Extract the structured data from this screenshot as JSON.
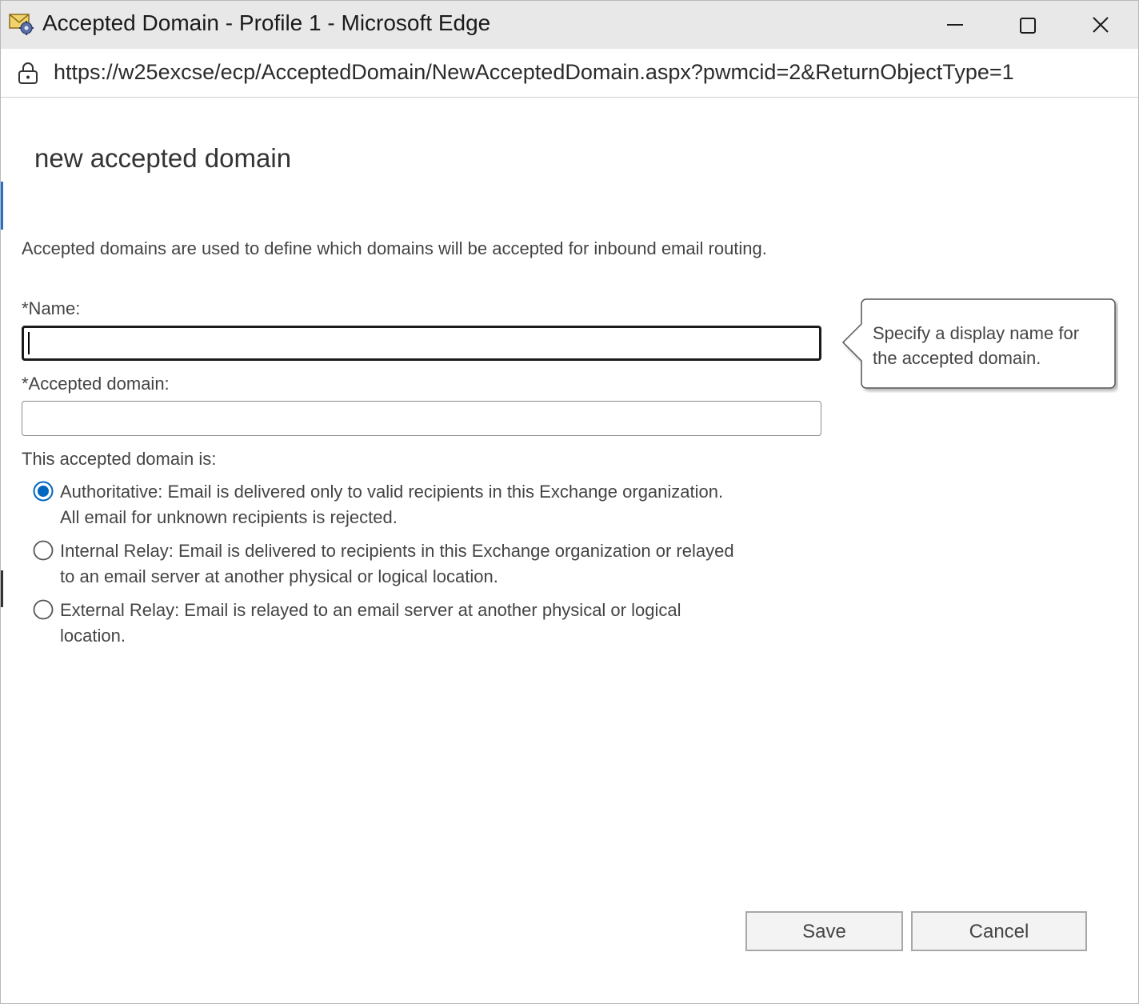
{
  "window": {
    "title": "Accepted Domain - Profile 1 - Microsoft Edge",
    "url": "https://w25excse/ecp/AcceptedDomain/NewAcceptedDomain.aspx?pwmcid=2&ReturnObjectType=1",
    "icons": {
      "app": "mail-gear-icon",
      "lock": "lock-icon",
      "minimize": "minimize-icon",
      "maximize": "maximize-icon",
      "close": "close-icon"
    }
  },
  "page": {
    "title": "new accepted domain",
    "description": "Accepted domains are used to define which domains will be accepted for inbound email routing."
  },
  "form": {
    "name_label": "*Name:",
    "name_value": "",
    "domain_label": "*Accepted domain:",
    "domain_value": "",
    "type_label": "This accepted domain is:",
    "options": [
      {
        "label": "Authoritative: Email is delivered only to valid recipients in this Exchange organization. All email for unknown recipients is rejected.",
        "selected": true
      },
      {
        "label": "Internal Relay: Email is delivered to recipients in this Exchange organization or relayed to an email server at another physical or logical location.",
        "selected": false
      },
      {
        "label": "External Relay: Email is relayed to an email server at another physical or logical location.",
        "selected": false
      }
    ]
  },
  "tooltip": {
    "text": "Specify a display name for the accepted domain."
  },
  "actions": {
    "save_label": "Save",
    "cancel_label": "Cancel"
  },
  "colors": {
    "accent": "#0067c0",
    "titlebar": "#e8e8e8",
    "text": "#444444"
  }
}
